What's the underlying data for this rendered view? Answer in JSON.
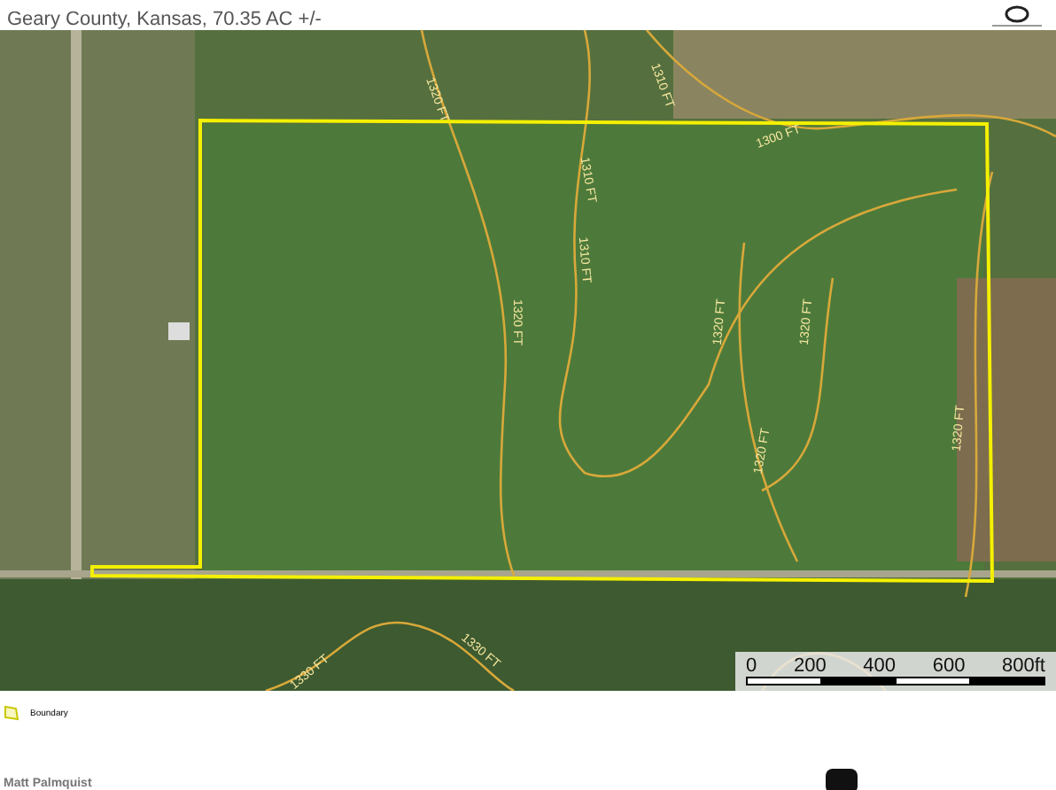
{
  "header": {
    "subtitle": "Geary County, Kansas, 70.35 AC +/-"
  },
  "map": {
    "contour_labels": [
      "1320 FT",
      "1310 FT",
      "1300 FT",
      "1310 FT",
      "1320 FT",
      "1310 FT",
      "1320 FT",
      "1320 FT",
      "1320 FT",
      "1320 FT",
      "1330 FT",
      "1330 FT"
    ],
    "scale_bar": {
      "ticks": [
        "0",
        "200",
        "400",
        "600",
        "800ft"
      ]
    }
  },
  "legend": [
    {
      "label": "Boundary"
    }
  ],
  "footer": {
    "agent": "Matt Palmquist"
  }
}
